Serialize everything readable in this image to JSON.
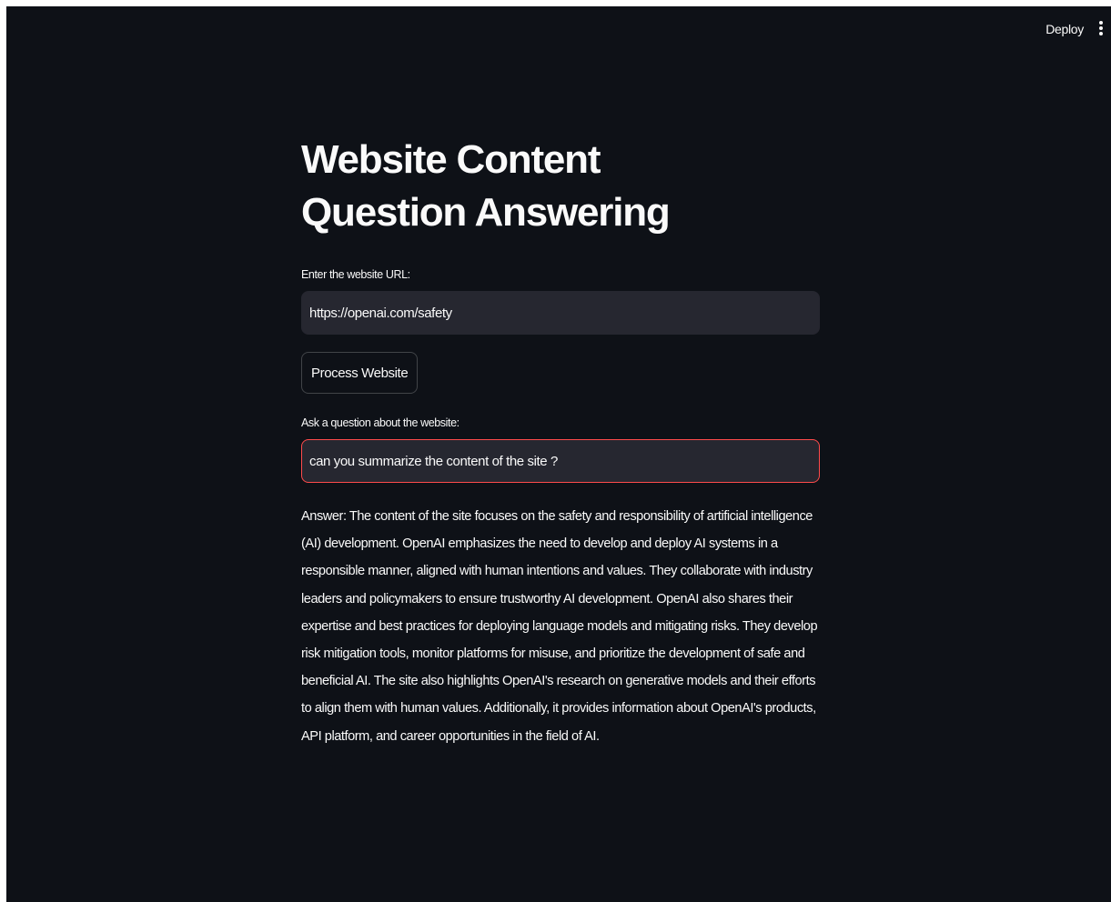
{
  "header": {
    "deploy_label": "Deploy",
    "menu_icon": "vertical-ellipsis-icon"
  },
  "main": {
    "title": "Website Content Question Answering",
    "url_label": "Enter the website URL:",
    "url_value": "https://openai.com/safety",
    "process_button_label": "Process Website",
    "question_label": "Ask a question about the website:",
    "question_value": "can you summarize the content of the site ?",
    "answer": "Answer: The content of the site focuses on the safety and responsibility of artificial intelligence (AI) development. OpenAI emphasizes the need to develop and deploy AI systems in a responsible manner, aligned with human intentions and values. They collaborate with industry leaders and policymakers to ensure trustworthy AI development. OpenAI also shares their expertise and best practices for deploying language models and mitigating risks. They develop risk mitigation tools, monitor platforms for misuse, and prioritize the development of safe and beneficial AI. The site also highlights OpenAI's research on generative models and their efforts to align them with human values. Additionally, it provides information about OpenAI's products, API platform, and career opportunities in the field of AI."
  },
  "colors": {
    "background": "#0e1117",
    "input_background": "#262730",
    "text": "#fafafa",
    "focus_border": "#ff4b4b"
  }
}
